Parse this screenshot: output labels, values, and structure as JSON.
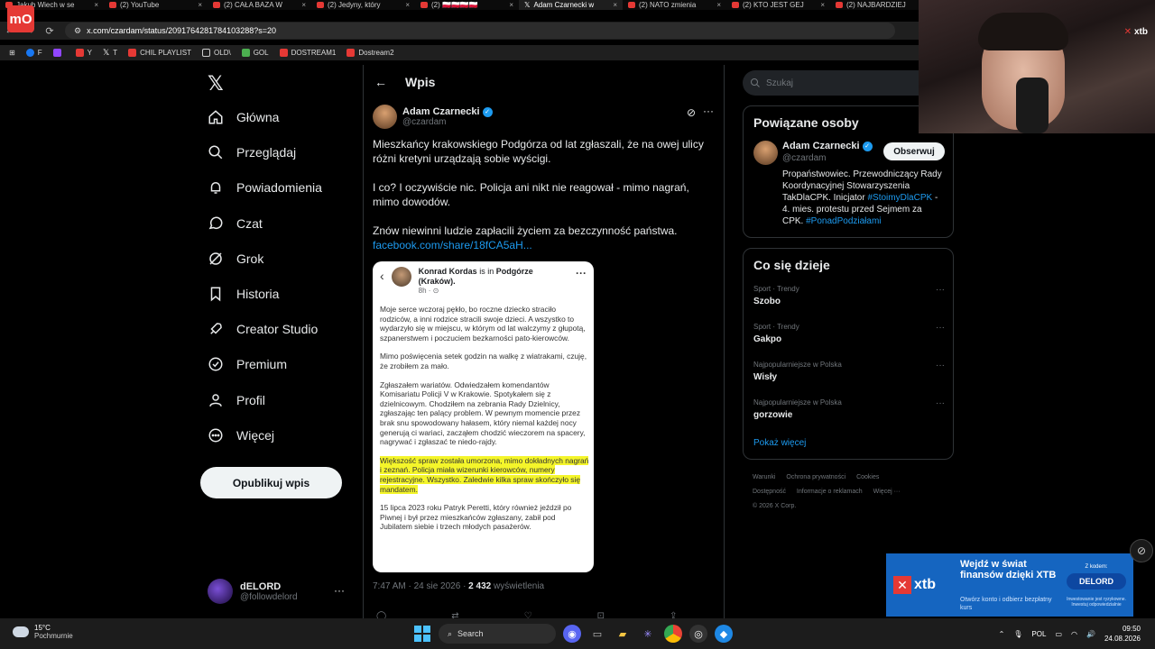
{
  "browser": {
    "tabs": [
      {
        "label": "Jakub Wiech w se",
        "icon": "youtube-icon",
        "active": false
      },
      {
        "label": "(2) YouTube",
        "icon": "youtube-icon",
        "active": false
      },
      {
        "label": "(2) CAŁA BAZA W",
        "icon": "youtube-icon",
        "active": false
      },
      {
        "label": "(2) Jedyny, który",
        "icon": "youtube-icon",
        "active": false
      },
      {
        "label": "(2) 🇵🇱🇵🇱🇵🇱🇵🇱",
        "icon": "youtube-icon",
        "active": false
      },
      {
        "label": "Adam Czarnecki w",
        "icon": "x-icon",
        "active": true
      },
      {
        "label": "(2) NATO zmienia",
        "icon": "youtube-icon",
        "active": false
      },
      {
        "label": "(2) KTO JEST GEJ",
        "icon": "youtube-icon",
        "active": false
      },
      {
        "label": "(2) NAJBARDZIEJ",
        "icon": "youtube-icon",
        "active": false
      }
    ],
    "url": "x.com/czardam/status/2091764281784103288?s=20",
    "bookmarks": [
      {
        "label": "F",
        "icon": "facebook-icon"
      },
      {
        "label": "",
        "icon": "twitch-icon"
      },
      {
        "label": "Y",
        "icon": "youtube-icon"
      },
      {
        "label": "T",
        "icon": "x-icon"
      },
      {
        "label": "CHIL PLAYLIST",
        "icon": "youtube-icon"
      },
      {
        "label": "OLD\\",
        "icon": "folder-icon"
      },
      {
        "label": "GOL",
        "icon": "gol-icon"
      },
      {
        "label": "DOSTREAM1",
        "icon": "youtube-icon"
      },
      {
        "label": "Dostream2",
        "icon": "youtube-icon"
      }
    ]
  },
  "overlay_logo": "mO",
  "nav": {
    "items": [
      {
        "label": "Główna",
        "icon": "home-icon"
      },
      {
        "label": "Przeglądaj",
        "icon": "search-icon"
      },
      {
        "label": "Powiadomienia",
        "icon": "bell-icon"
      },
      {
        "label": "Czat",
        "icon": "chat-icon"
      },
      {
        "label": "Grok",
        "icon": "grok-icon"
      },
      {
        "label": "Historia",
        "icon": "bookmark-icon"
      },
      {
        "label": "Creator Studio",
        "icon": "rocket-icon"
      },
      {
        "label": "Premium",
        "icon": "premium-icon"
      },
      {
        "label": "Profil",
        "icon": "person-icon"
      },
      {
        "label": "Więcej",
        "icon": "more-icon"
      }
    ],
    "post_button": "Opublikuj wpis",
    "account": {
      "name": "dELORD",
      "handle": "@followdelord",
      "more": "···"
    }
  },
  "post": {
    "header_title": "Wpis",
    "author_name": "Adam Czarnecki",
    "author_handle": "@czardam",
    "paragraphs": [
      "Mieszkańcy krakowskiego Podgórza od lat zgłaszali, że na owej ulicy różni kretyni urządzają sobie wyścigi.",
      "I co? I oczywiście nic. Policja ani nikt nie reagował - mimo nagrań, mimo dowodów.",
      "Znów niewinni ludzie zapłacili życiem za bezczynność państwa."
    ],
    "link": "facebook.com/share/18fCA5aH...",
    "time": "7:47 AM · 24 sie 2026 · ",
    "views_count": "2 432",
    "views_label": " wyświetlenia",
    "embedded": {
      "author": "Konrad Kordas",
      "is_in": " is in ",
      "place": "Podgórze (Kraków).",
      "time": "8h · ⊙",
      "paragraphs": [
        "Moje serce wczoraj pękło, bo roczne dziecko straciło rodziców, a inni rodzice stracili swoje dzieci. A wszystko to wydarzyło się w miejscu, w którym od lat walczymy z głupotą, szpanerstwem i poczuciem bezkarności pato-kierowców.",
        "Mimo poświęcenia setek godzin na walkę z wiatrakami, czuję, że zrobiłem za mało.",
        "Zgłaszałem wariatów. Odwiedzałem komendantów Komisariatu Policji V w Krakowie. Spotykałem się z dzielnicowym. Chodziłem na zebrania Rady Dzielnicy, zgłaszając ten palący problem. W pewnym momencie przez brak snu spowodowany hałasem, który niemal każdej nocy generują ci wariaci, zacząłem chodzić wieczorem na spacery, nagrywać i zgłaszać te niedo-rajdy.",
        "Większość spraw została umorzona, mimo dokładnych nagrań i zeznań. Policja miała wizerunki kierowców, numery rejestracyjne. Wszystko. Zaledwie kilka spraw skończyło się mandatem.",
        "15 lipca 2023 roku Patryk Peretti, który również jeździł po Piwnej i był przez mieszkańców zgłaszany, zabił pod Jubilatem siebie i trzech młodych pasażerów."
      ]
    }
  },
  "right": {
    "search_placeholder": "Szukaj",
    "related_title": "Powiązane osoby",
    "related": {
      "name": "Adam Czarnecki",
      "handle": "@czardam",
      "follow": "Obserwuj",
      "bio": "Propaństwowiec. Przewodniczący Rady Koordynacyjnej Stowarzyszenia TakDlaCPK. Inicjator ",
      "bio_tag": "#StoimyDlaCPK",
      "bio_2": " - 4. mies. protestu przed Sejmem za CPK. ",
      "bio_tag2": "#PonadPodziałami"
    },
    "trends_title": "Co się dzieje",
    "trends": [
      {
        "category": "Sport · Trendy",
        "name": "Szobo"
      },
      {
        "category": "Sport · Trendy",
        "name": "Gakpo"
      },
      {
        "category": "Najpopularniejsze w Polska",
        "name": "Wisły"
      },
      {
        "category": "Najpopularniejsze w Polska",
        "name": "gorzowie"
      }
    ],
    "show_more": "Pokaż więcej",
    "footer": [
      "Warunki",
      "Ochrona prywatności",
      "Cookies",
      "Dostępność",
      "Informacje o reklamach",
      "Więcej ···",
      "© 2026 X Corp."
    ]
  },
  "webcam_badge": "xtb",
  "ad": {
    "brand": "xtb",
    "headline": "Wejdź w świat finansów dzięki XTB",
    "subline": "Otwórz konto i odbierz bezpłatny kurs",
    "code_label": "Z kodem:",
    "code": "DELORD",
    "disclaimer": "Inwestowanie jest ryzykowne. Inwestuj odpowiedzialnie"
  },
  "taskbar": {
    "temperature": "15°C",
    "weather": "Pochmurnie",
    "search": "Search",
    "language": "POL",
    "time": "09:50",
    "date": "24.08.2026"
  },
  "colors": {
    "accent": "#1d9bf0",
    "highlight": "#f4f52a",
    "ad_blue": "#1565c0"
  }
}
